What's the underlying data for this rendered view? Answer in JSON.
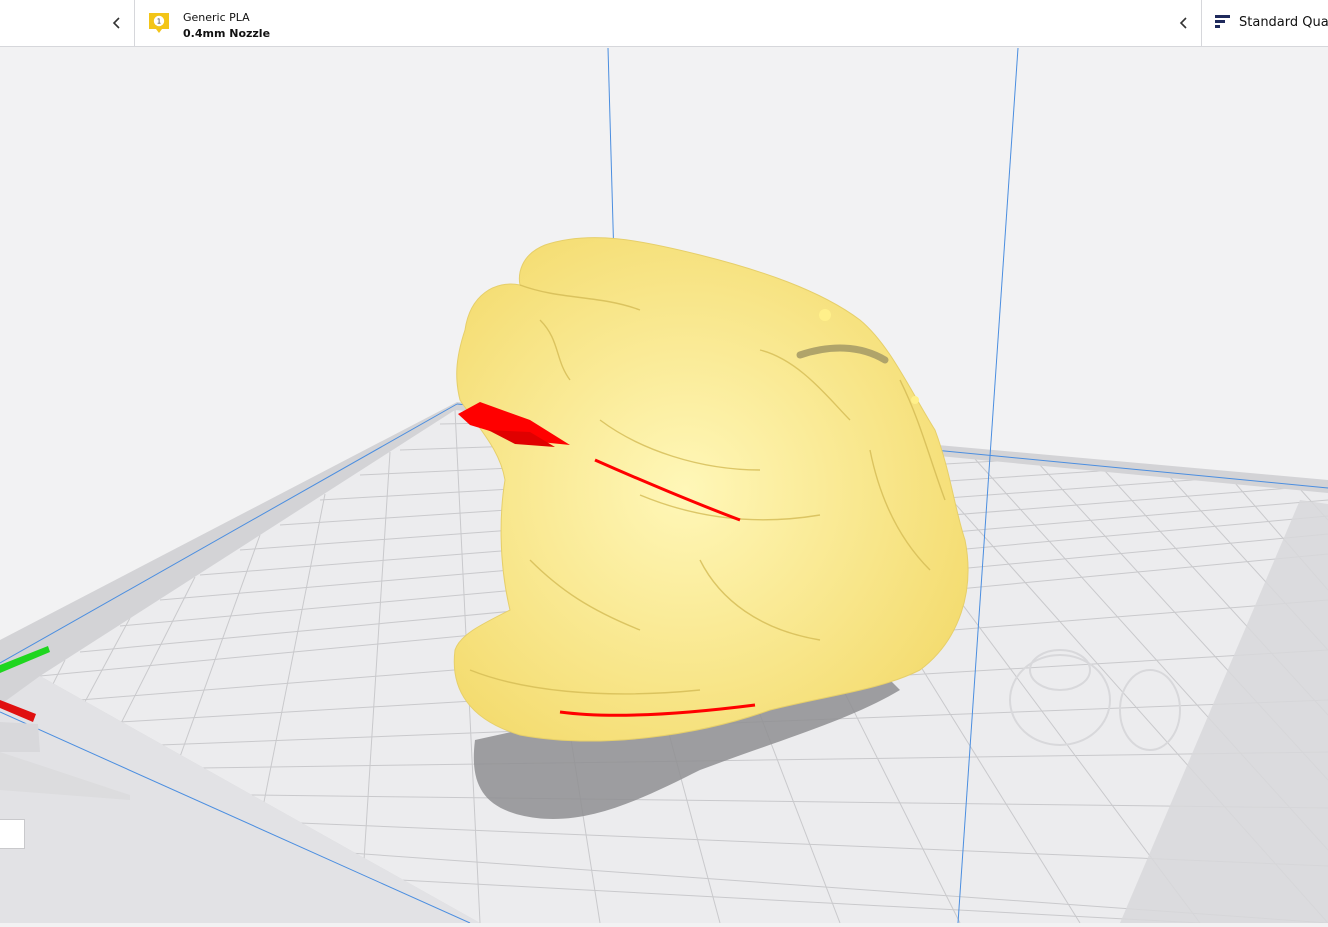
{
  "header": {
    "material": {
      "extruder_number": "1",
      "name": "Generic PLA",
      "nozzle": "0.4mm Nozzle"
    },
    "quality": {
      "label": "Standard Quali"
    }
  },
  "icons": {
    "collapse_left": "chevron-left-icon",
    "badge": "extruder-badge-icon",
    "quality": "quality-settings-icon"
  },
  "colors": {
    "model": "#fbe98c",
    "overhang": "#ff0000",
    "bed": "#e9e9eb",
    "bed_border": "#d0d0d3",
    "grid": "#c6c6c9",
    "axis_blue": "#4b8ee0",
    "axis_x": "#e01010",
    "axis_y": "#1fd61f",
    "accent": "#f3c518"
  }
}
